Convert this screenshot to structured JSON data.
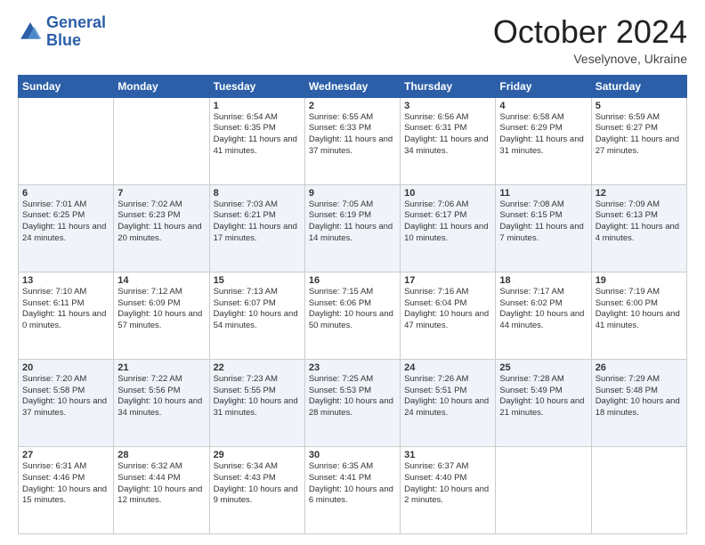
{
  "header": {
    "logo_line1": "General",
    "logo_line2": "Blue",
    "month": "October 2024",
    "location": "Veselynove, Ukraine"
  },
  "weekdays": [
    "Sunday",
    "Monday",
    "Tuesday",
    "Wednesday",
    "Thursday",
    "Friday",
    "Saturday"
  ],
  "weeks": [
    [
      {
        "day": "",
        "info": ""
      },
      {
        "day": "",
        "info": ""
      },
      {
        "day": "1",
        "info": "Sunrise: 6:54 AM\nSunset: 6:35 PM\nDaylight: 11 hours and 41 minutes."
      },
      {
        "day": "2",
        "info": "Sunrise: 6:55 AM\nSunset: 6:33 PM\nDaylight: 11 hours and 37 minutes."
      },
      {
        "day": "3",
        "info": "Sunrise: 6:56 AM\nSunset: 6:31 PM\nDaylight: 11 hours and 34 minutes."
      },
      {
        "day": "4",
        "info": "Sunrise: 6:58 AM\nSunset: 6:29 PM\nDaylight: 11 hours and 31 minutes."
      },
      {
        "day": "5",
        "info": "Sunrise: 6:59 AM\nSunset: 6:27 PM\nDaylight: 11 hours and 27 minutes."
      }
    ],
    [
      {
        "day": "6",
        "info": "Sunrise: 7:01 AM\nSunset: 6:25 PM\nDaylight: 11 hours and 24 minutes."
      },
      {
        "day": "7",
        "info": "Sunrise: 7:02 AM\nSunset: 6:23 PM\nDaylight: 11 hours and 20 minutes."
      },
      {
        "day": "8",
        "info": "Sunrise: 7:03 AM\nSunset: 6:21 PM\nDaylight: 11 hours and 17 minutes."
      },
      {
        "day": "9",
        "info": "Sunrise: 7:05 AM\nSunset: 6:19 PM\nDaylight: 11 hours and 14 minutes."
      },
      {
        "day": "10",
        "info": "Sunrise: 7:06 AM\nSunset: 6:17 PM\nDaylight: 11 hours and 10 minutes."
      },
      {
        "day": "11",
        "info": "Sunrise: 7:08 AM\nSunset: 6:15 PM\nDaylight: 11 hours and 7 minutes."
      },
      {
        "day": "12",
        "info": "Sunrise: 7:09 AM\nSunset: 6:13 PM\nDaylight: 11 hours and 4 minutes."
      }
    ],
    [
      {
        "day": "13",
        "info": "Sunrise: 7:10 AM\nSunset: 6:11 PM\nDaylight: 11 hours and 0 minutes."
      },
      {
        "day": "14",
        "info": "Sunrise: 7:12 AM\nSunset: 6:09 PM\nDaylight: 10 hours and 57 minutes."
      },
      {
        "day": "15",
        "info": "Sunrise: 7:13 AM\nSunset: 6:07 PM\nDaylight: 10 hours and 54 minutes."
      },
      {
        "day": "16",
        "info": "Sunrise: 7:15 AM\nSunset: 6:06 PM\nDaylight: 10 hours and 50 minutes."
      },
      {
        "day": "17",
        "info": "Sunrise: 7:16 AM\nSunset: 6:04 PM\nDaylight: 10 hours and 47 minutes."
      },
      {
        "day": "18",
        "info": "Sunrise: 7:17 AM\nSunset: 6:02 PM\nDaylight: 10 hours and 44 minutes."
      },
      {
        "day": "19",
        "info": "Sunrise: 7:19 AM\nSunset: 6:00 PM\nDaylight: 10 hours and 41 minutes."
      }
    ],
    [
      {
        "day": "20",
        "info": "Sunrise: 7:20 AM\nSunset: 5:58 PM\nDaylight: 10 hours and 37 minutes."
      },
      {
        "day": "21",
        "info": "Sunrise: 7:22 AM\nSunset: 5:56 PM\nDaylight: 10 hours and 34 minutes."
      },
      {
        "day": "22",
        "info": "Sunrise: 7:23 AM\nSunset: 5:55 PM\nDaylight: 10 hours and 31 minutes."
      },
      {
        "day": "23",
        "info": "Sunrise: 7:25 AM\nSunset: 5:53 PM\nDaylight: 10 hours and 28 minutes."
      },
      {
        "day": "24",
        "info": "Sunrise: 7:26 AM\nSunset: 5:51 PM\nDaylight: 10 hours and 24 minutes."
      },
      {
        "day": "25",
        "info": "Sunrise: 7:28 AM\nSunset: 5:49 PM\nDaylight: 10 hours and 21 minutes."
      },
      {
        "day": "26",
        "info": "Sunrise: 7:29 AM\nSunset: 5:48 PM\nDaylight: 10 hours and 18 minutes."
      }
    ],
    [
      {
        "day": "27",
        "info": "Sunrise: 6:31 AM\nSunset: 4:46 PM\nDaylight: 10 hours and 15 minutes."
      },
      {
        "day": "28",
        "info": "Sunrise: 6:32 AM\nSunset: 4:44 PM\nDaylight: 10 hours and 12 minutes."
      },
      {
        "day": "29",
        "info": "Sunrise: 6:34 AM\nSunset: 4:43 PM\nDaylight: 10 hours and 9 minutes."
      },
      {
        "day": "30",
        "info": "Sunrise: 6:35 AM\nSunset: 4:41 PM\nDaylight: 10 hours and 6 minutes."
      },
      {
        "day": "31",
        "info": "Sunrise: 6:37 AM\nSunset: 4:40 PM\nDaylight: 10 hours and 2 minutes."
      },
      {
        "day": "",
        "info": ""
      },
      {
        "day": "",
        "info": ""
      }
    ]
  ]
}
